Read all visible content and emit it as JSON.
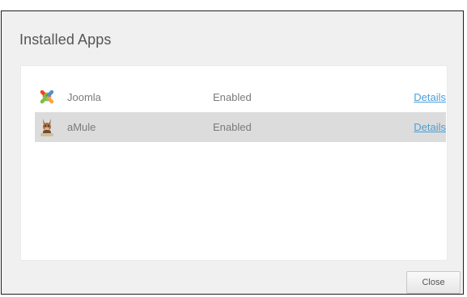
{
  "dialog": {
    "title": "Installed Apps",
    "close_label": "Close"
  },
  "apps": [
    {
      "name": "Joomla",
      "status": "Enabled",
      "details_label": "Details",
      "icon": "joomla-logo-icon"
    },
    {
      "name": "aMule",
      "status": "Enabled",
      "details_label": "Details",
      "icon": "amule-mule-icon"
    }
  ],
  "colors": {
    "title_text": "#555555",
    "row_text": "#7a7a7a",
    "link": "#4a9fd8",
    "selected_row": "#dcdcdc",
    "dialog_bg": "#f0f0f0"
  }
}
